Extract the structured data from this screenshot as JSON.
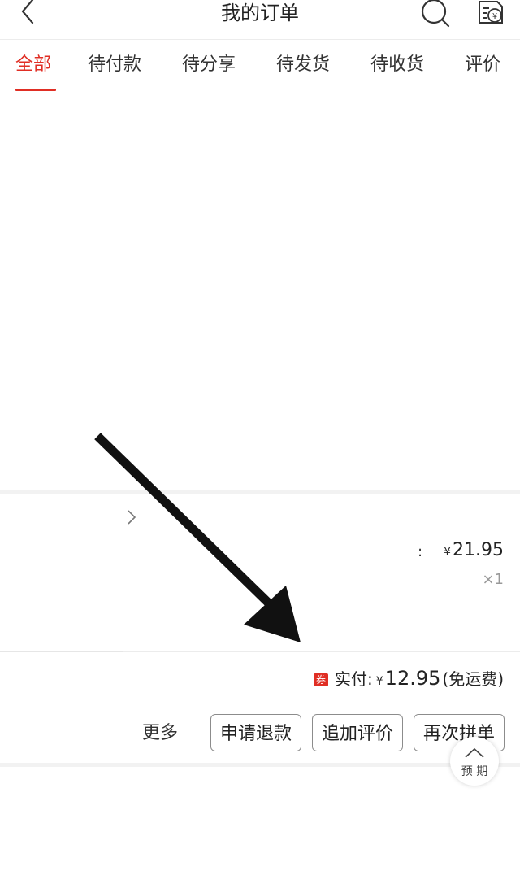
{
  "header": {
    "title": "我的订单",
    "back_icon": "chevron-left-icon",
    "search_icon": "search-icon",
    "bill_icon": "yen-bill-icon"
  },
  "tabs": [
    {
      "label": "全部",
      "active": true
    },
    {
      "label": "待付款"
    },
    {
      "label": "待分享"
    },
    {
      "label": "待发货"
    },
    {
      "label": "待收货"
    },
    {
      "label": "评价"
    }
  ],
  "order": {
    "currency": "¥",
    "price": "21.95",
    "quantity": "×1",
    "pay_label": "实付:",
    "pay_amount": "12.95",
    "shipping_note": "(免运费)",
    "coupon_badge": "券"
  },
  "actions": {
    "more": "更多",
    "refund": "申请退款",
    "add_review": "追加评价",
    "regroup": "再次拼单"
  },
  "fold_button": {
    "label": "预 期"
  },
  "colors": {
    "accent": "#e02e24",
    "divider": "#f2f2f2",
    "muted": "#999999"
  }
}
